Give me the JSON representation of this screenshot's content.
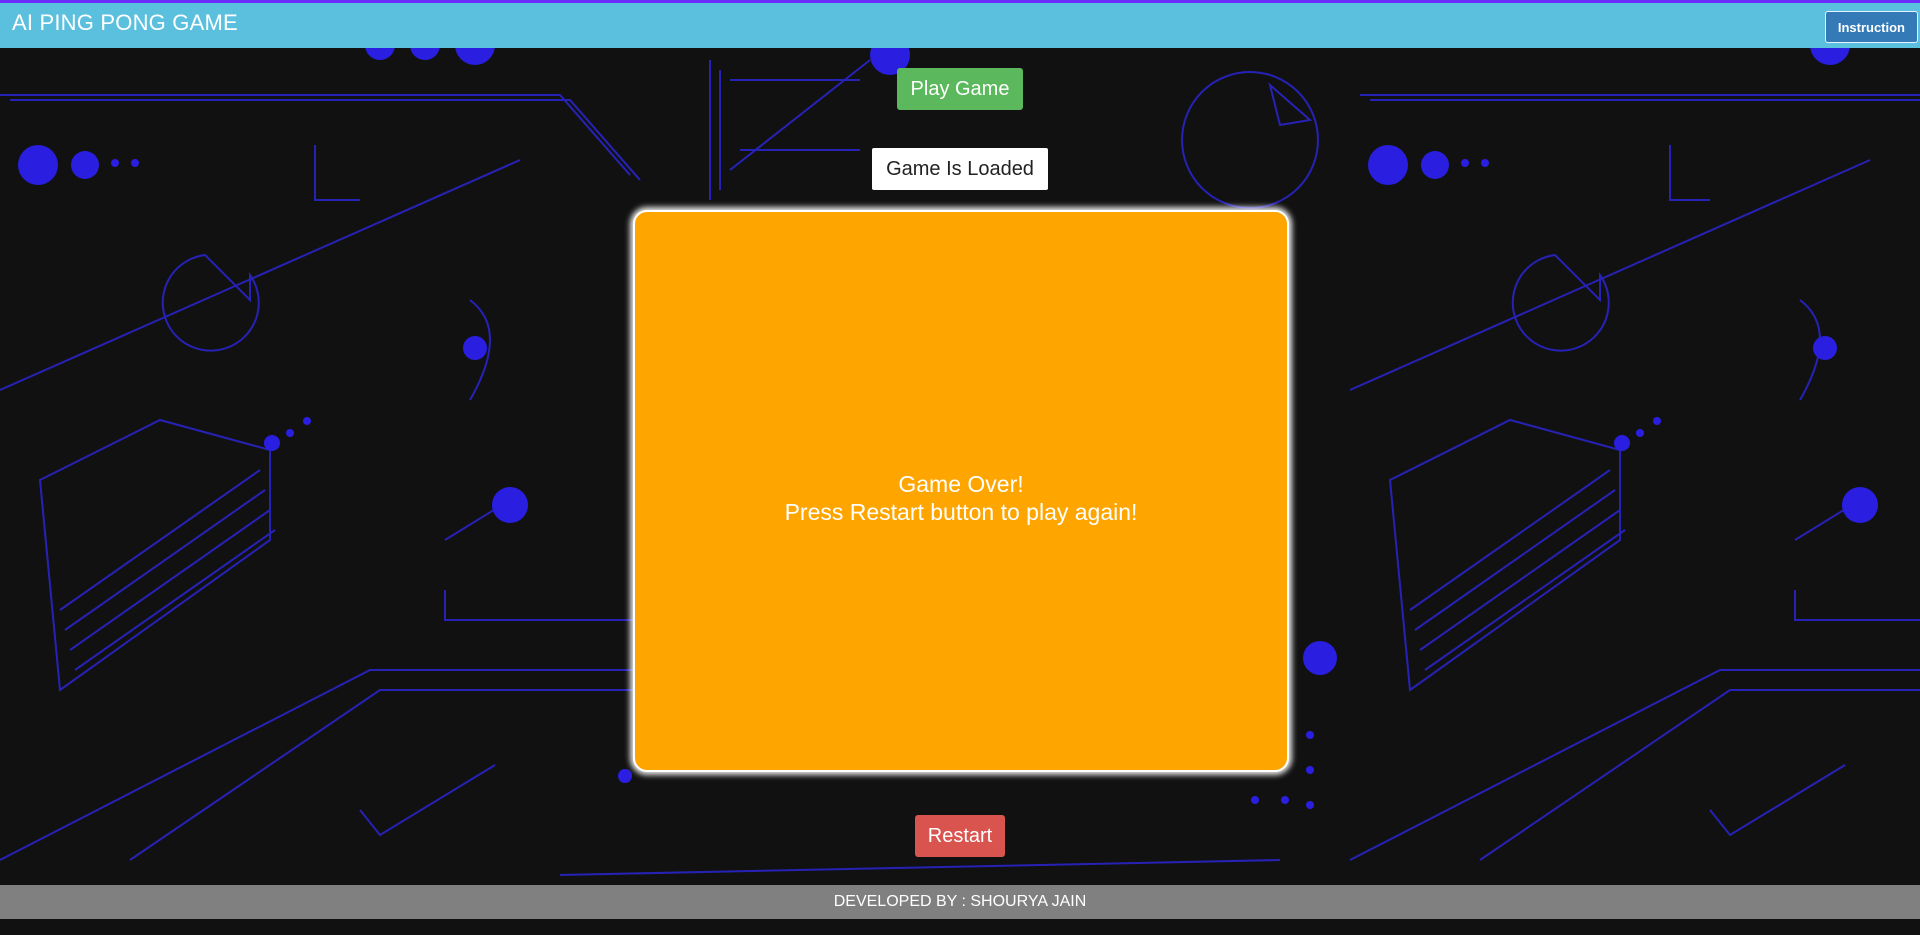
{
  "header": {
    "title": "AI PING PONG GAME",
    "instruction_label": "Instruction"
  },
  "controls": {
    "play_label": "Play Game",
    "status_text": "Game Is Loaded",
    "restart_label": "Restart"
  },
  "board": {
    "line1": "Game Over!",
    "line2": "Press Restart button to play again!"
  },
  "footer": {
    "text": "DEVELOPED BY : SHOURYA JAIN"
  },
  "colors": {
    "background": "#111111",
    "header": "#5bc0de",
    "play_button": "#5cb85c",
    "restart_button": "#d9534f",
    "board": "#ffa500",
    "decor_blue": "#2a1fe0"
  }
}
